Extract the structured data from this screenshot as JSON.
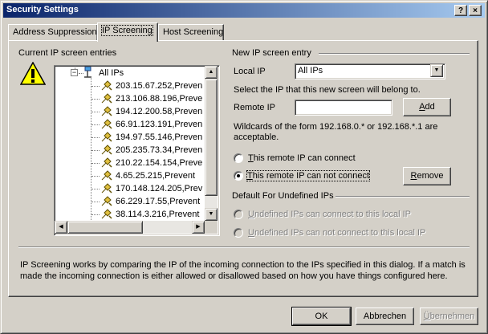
{
  "window": {
    "title": "Security Settings",
    "help_label": "?",
    "close_label": "×"
  },
  "tabs": [
    {
      "label": "Address Suppression"
    },
    {
      "label": "IP Screening",
      "active": true
    },
    {
      "label": "Host Screening"
    }
  ],
  "current_entries": {
    "group_label": "Current IP screen entries",
    "root_label": "All IPs",
    "root_expander": "−",
    "items": [
      "203.15.67.252,Preven",
      "213.106.88.196,Preve",
      "194.12.200.58,Preven",
      "66.91.123.191,Preven",
      "194.97.55.146,Preven",
      "205.235.73.34,Preven",
      "210.22.154.154,Preve",
      "4.65.25.215,Prevent",
      "170.148.124.205,Prev",
      "66.229.17.55,Prevent",
      "38.114.3.216,Prevent"
    ]
  },
  "new_entry": {
    "group_label": "New IP screen entry",
    "local_ip_label": "Local IP",
    "local_ip_value": "All IPs",
    "select_hint": "Select the IP that this new screen will belong to.",
    "remote_ip_label": "Remote IP",
    "remote_ip_value": "",
    "add_label": "Add",
    "wildcard_hint_1": "Wildcards of the form 192.168.0.* or 192.168.*.1 are",
    "wildcard_hint_2": "acceptable.",
    "radio_can_connect": "This remote IP can connect",
    "radio_cannot_connect": "This remote IP can not connect",
    "remove_label": "Remove"
  },
  "default_undefined": {
    "group_label": "Default For Undefined IPs",
    "can_connect": "Undefined IPs can connect to this local IP",
    "cannot_connect": "Undefined IPs can not connect to this local IP"
  },
  "description_1": "IP Screening works by comparing the IP of the incoming connection to the IPs specified in this dialog.  If a match is",
  "description_2": "made the incoming connection is either allowed or disallowed based on how you have things configured here.",
  "footer": {
    "ok_label": "OK",
    "cancel_label": "Abbrechen",
    "apply_label": "Übernehmen"
  },
  "colors": {
    "title_start": "#0a246a",
    "title_end": "#a6caf0",
    "warning_yellow": "#ffff00",
    "face": "#d4d0c8"
  }
}
